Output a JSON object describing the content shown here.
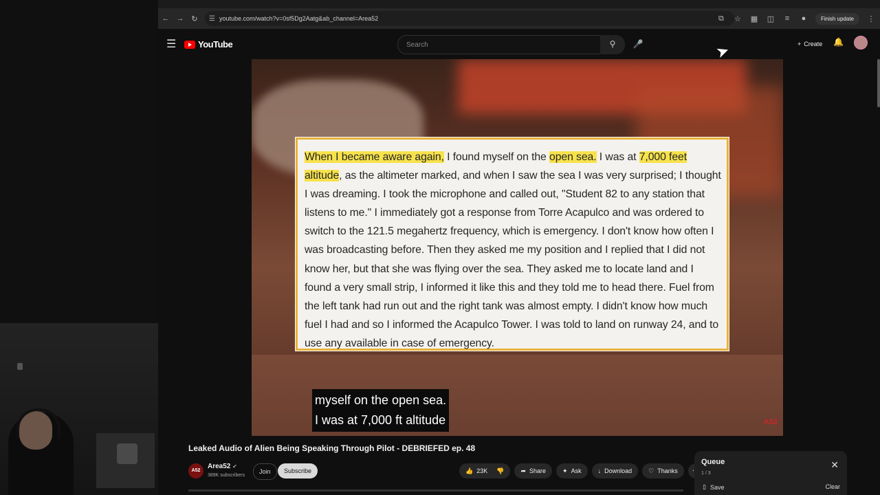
{
  "browser": {
    "url": "youtube.com/watch?v=0sf5Dg2Aatg&ab_channel=Area52",
    "finish_update": "Finish update"
  },
  "masthead": {
    "logo_text": "YouTube",
    "search_placeholder": "Search",
    "create_label": "Create"
  },
  "video": {
    "transcript": {
      "h1": "When I became aware again,",
      "t1": " I found myself on the ",
      "h2": "open sea.",
      "t2": " I was at ",
      "h3": "7,000 feet altitude",
      "t3": ", as the altimeter marked, and when I saw the sea I was very surprised; I thought I was dreaming. I took the microphone and called out, \"Student 82 to any station that listens to me.\" I immediately got a response from Torre Acapulco and was ordered to switch to the 121.5 megahertz frequency, which is emergency. I don't know how often I was broadcasting before. Then they asked me my position and I replied that I did not know her, but that she was flying over the sea. They asked me to locate land and I found a very small strip, I informed it like this and they told me to head there. Fuel from the left tank had run out and the right tank was almost empty. I didn't know how much fuel I had and so I informed the Acapulco Tower. I was told to land on runway 24, and to use any available in case of emergency."
    },
    "caption_lines": [
      "myself on the open sea.",
      "I was at 7,000 ft altitude"
    ],
    "watermark": "A52"
  },
  "info": {
    "title": "Leaked Audio of Alien Being Speaking Through Pilot - DEBRIEFED ep. 48",
    "channel_avatar": "A52",
    "channel_name": "Area52",
    "subscribers": "389K subscribers",
    "join_label": "Join",
    "subscribe_label": "Subscribe",
    "like_count": "23K",
    "share_label": "Share",
    "ask_label": "Ask",
    "download_label": "Download",
    "thanks_label": "Thanks",
    "more_label": "···"
  },
  "queue": {
    "title": "Queue",
    "count": "1 / 3",
    "save_label": "Save",
    "clear_label": "Clear"
  }
}
